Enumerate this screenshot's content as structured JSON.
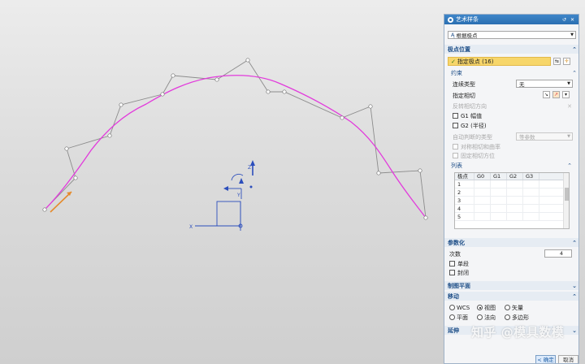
{
  "panel": {
    "title": "艺术样条",
    "type_select": "根据极点",
    "section_pole_position": "极点位置",
    "specify_pole": "指定极点 (16)",
    "sub_constraint": "约束",
    "continuity_type_label": "连续类型",
    "continuity_type_value": "无",
    "specify_tangent_label": "指定相切",
    "reverse_tangent_label": "反转相切方向",
    "g1_label": "G1 幅值",
    "g2_label": "G2 (半径)",
    "param_type_label": "自动判断的类型",
    "param_type_value": "等参数",
    "adjust_direction_label": "对称相切和曲率",
    "fix_parameter_label": "固定相切方位",
    "sub_list": "列表",
    "grid_headers": [
      "极点",
      "G0",
      "G1",
      "G2",
      "G3"
    ],
    "grid_rows": [
      "1",
      "2",
      "3",
      "4",
      "5"
    ],
    "section_parameterize": "参数化",
    "degree_label": "次数",
    "degree_value": "4",
    "single_segment_label": "单段",
    "closed_label": "封闭",
    "section_drawing_plane": "制图平面",
    "section_move": "移动",
    "radio_wcs": "WCS",
    "radio_view": "视图",
    "radio_vector": "矢量",
    "radio_plane": "平面",
    "radio_normal": "法向",
    "radio_polygon": "多边形",
    "section_extend": "延伸",
    "ok_label": "< 确定 >",
    "cancel_label": "取消"
  },
  "viewport": {
    "axis_x_label": "X",
    "axis_y_label": "Y",
    "axis_z_label": "Z",
    "curve_color": "#e23bdc",
    "polygon_color": "#8a8a8a",
    "accent_color": "#2c4ebc"
  },
  "watermark": "知乎 @模具数模"
}
